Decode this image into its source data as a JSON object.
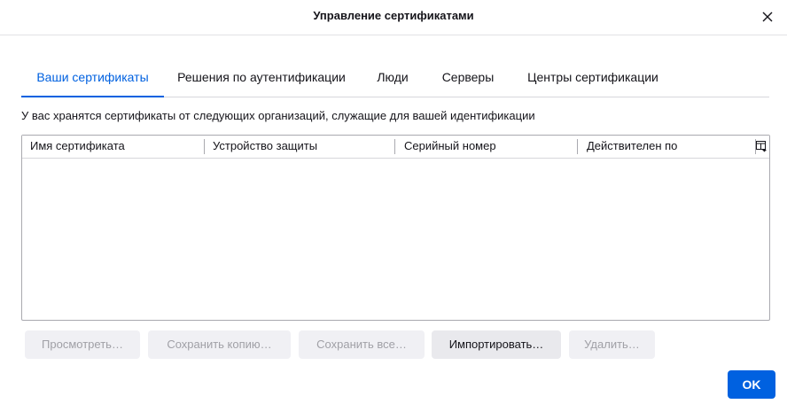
{
  "dialog": {
    "title": "Управление сертификатами"
  },
  "tabs": [
    {
      "label": "Ваши сертификаты",
      "selected": true
    },
    {
      "label": "Решения по аутентификации",
      "selected": false
    },
    {
      "label": "Люди",
      "selected": false
    },
    {
      "label": "Серверы",
      "selected": false
    },
    {
      "label": "Центры сертификации",
      "selected": false
    }
  ],
  "description": "У вас хранятся сертификаты от следующих организаций, служащие для вашей идентификации",
  "table": {
    "columns": [
      "Имя сертификата",
      "Устройство защиты",
      "Серийный номер",
      "Действителен по"
    ],
    "rows": []
  },
  "buttons": {
    "view": "Просмотреть…",
    "backup": "Сохранить копию…",
    "backup_all": "Сохранить все…",
    "import": "Импортировать…",
    "delete": "Удалить…",
    "ok": "OK"
  },
  "icons": {
    "close": "close-icon",
    "column_picker": "column-picker-icon"
  },
  "colors": {
    "accent": "#0061e0",
    "text": "#15141a",
    "disabled_text": "#a0a0a6",
    "button_bg": "#e9e9ed"
  }
}
